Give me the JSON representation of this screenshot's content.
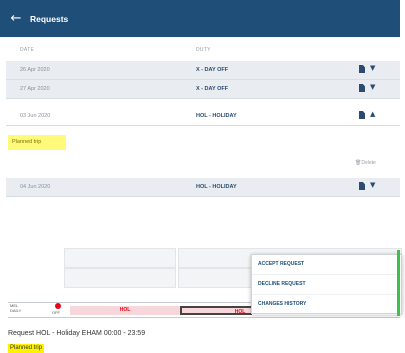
{
  "header": {
    "back_icon": "arrow-left-icon",
    "title": "Requests"
  },
  "table": {
    "columns": [
      "DATE",
      "DUTY"
    ],
    "rows": [
      {
        "date": "26 Apr 2020",
        "duty": "X - DAY OFF",
        "shaded": true
      },
      {
        "date": "27 Apr 2020",
        "duty": "X - DAY OFF",
        "shaded": true
      },
      {
        "date": "03 Jun 2020",
        "duty": "HOL - HOLIDAY",
        "shaded": false
      },
      {
        "date": "04 Jun 2020",
        "duty": "HOL - HOLIDAY",
        "shaded": true
      }
    ]
  },
  "expanded": {
    "comment": "Planned trip",
    "delete_label": "Delete"
  },
  "roster": {
    "label_top": "MEL",
    "label_mid": "DAILY",
    "off_label": "OFF",
    "segments": [
      "HOL",
      "HOL"
    ]
  },
  "context_menu": {
    "items": [
      "ACCEPT REQUEST",
      "DECLINE REQUEST",
      "CHANGES HISTORY"
    ]
  },
  "details": {
    "request_line": "Request HOL - Holiday EHAM 00:00 - 23:59",
    "comment": "Planned trip"
  },
  "colors": {
    "header_bg": "#1f4e79",
    "highlight": "#fff200",
    "hol_red": "#e30613"
  }
}
